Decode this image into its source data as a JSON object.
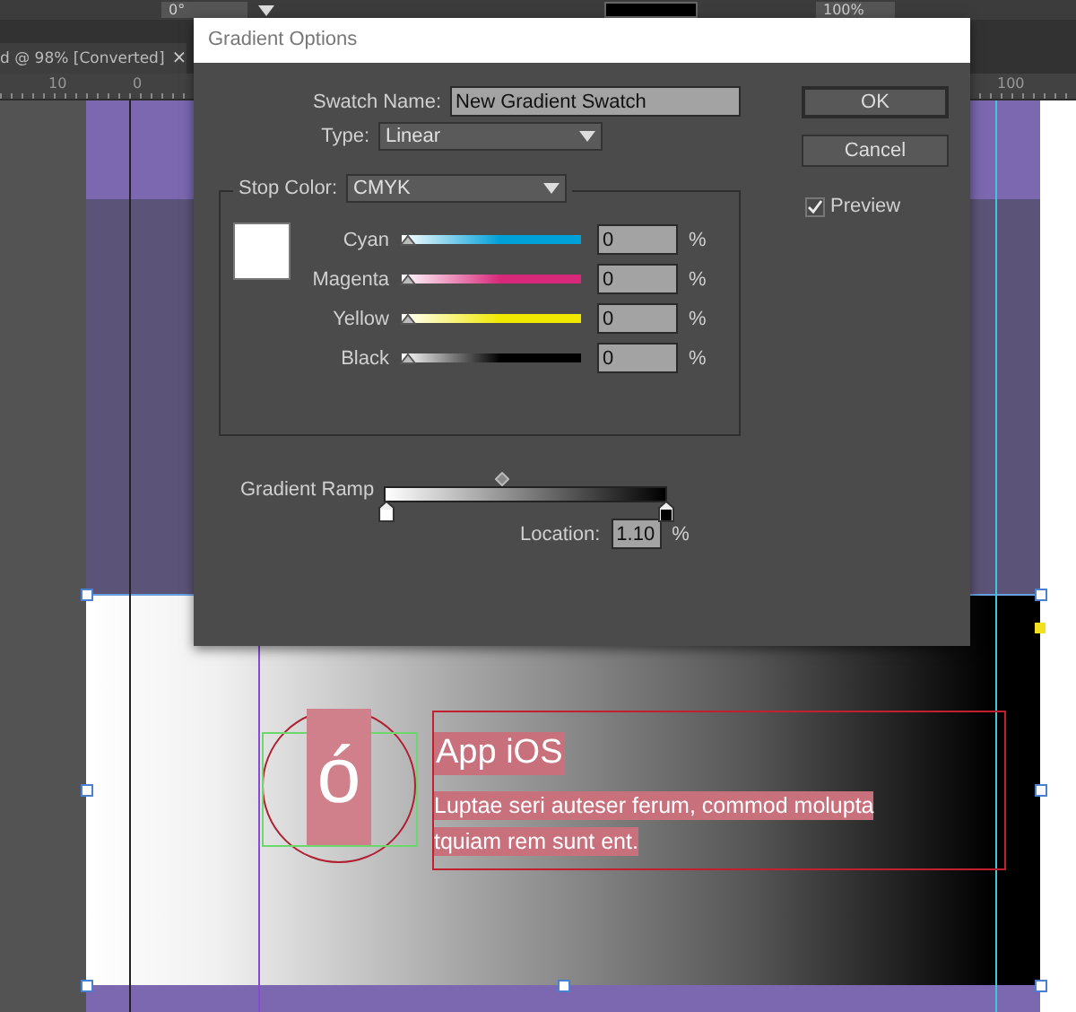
{
  "toolbar": {
    "angle": "0°",
    "opacity": "100%"
  },
  "document_tab": {
    "title": "d @ 98% [Converted]",
    "close": "×"
  },
  "ruler": {
    "ticks": [
      "10",
      "0",
      "100"
    ]
  },
  "dialog": {
    "title": "Gradient Options",
    "swatch_name_label": "Swatch Name:",
    "swatch_name": "New Gradient Swatch",
    "type_label": "Type:",
    "type": "Linear",
    "stop_color_label": "Stop Color:",
    "stop_color_mode": "CMYK",
    "channels": [
      {
        "name": "Cyan",
        "level": 0,
        "value": "0",
        "unit": "%",
        "color": "#00a0d8"
      },
      {
        "name": "Magenta",
        "level": 0,
        "value": "0",
        "unit": "%",
        "color": "#d8287a"
      },
      {
        "name": "Yellow",
        "level": 0,
        "value": "0",
        "unit": "%",
        "color": "#f0e800"
      },
      {
        "name": "Black",
        "level": 0,
        "value": "0",
        "unit": "%",
        "color": "#000000"
      }
    ],
    "gradient_ramp_label": "Gradient Ramp",
    "ramp_stops": [
      {
        "color": "#ffffff"
      },
      {
        "color": "#000000"
      }
    ],
    "location_label": "Location:",
    "location": "1.10",
    "location_unit": "%",
    "buttons": [
      "OK",
      "Cancel"
    ],
    "preview": {
      "label": "Preview",
      "checked": true
    }
  },
  "artboard": {
    "icon_letter": "ó",
    "heading": "App iOS",
    "body_lines": [
      "Luptae seri auteser ferum, commod molupta",
      "tquiam rem sunt ent."
    ]
  }
}
